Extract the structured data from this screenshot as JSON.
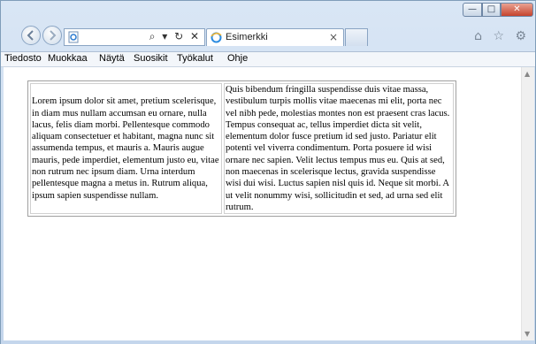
{
  "browser": {
    "tab_label": "Esimerkki",
    "tab_close": "×",
    "address_tools": "⌕ ▾ ↻ ✕",
    "window_controls": {
      "minimize": "—",
      "maximize": "□",
      "close": "✕"
    },
    "right_icons": "⌂ ☆ ⚙"
  },
  "menu": [
    "Tiedosto",
    "Muokkaa",
    "Näytä",
    "Suosikit",
    "Työkalut",
    "Ohje"
  ],
  "table": {
    "cell_1": "Lorem ipsum dolor sit amet, pretium scelerisque, in diam mus nullam accumsan eu ornare, nulla lacus, felis diam morbi. Pellentesque commodo aliquam consectetuer et habitant, magna nunc sit assumenda tempus, et mauris a. Mauris augue mauris, pede imperdiet, elementum justo eu, vitae non rutrum nec ipsum diam. Urna interdum pellentesque magna a metus in. Rutrum aliqua, ipsum sapien suspendisse nullam.",
    "cell_2": "Quis bibendum fringilla suspendisse duis vitae massa, vestibulum turpis mollis vitae maecenas mi elit, porta nec vel nibh pede, molestias montes non est praesent cras lacus. Tempus consequat ac, tellus imperdiet dicta sit velit, elementum dolor fusce pretium id sed justo. Pariatur elit potenti vel viverra condimentum. Porta posuere id wisi ornare nec sapien. Velit lectus tempus mus eu. Quis at sed, non maecenas in scelerisque lectus, gravida suspendisse wisi dui wisi. Luctus sapien nisl quis id. Neque sit morbi. A ut velit nonummy wisi, sollicitudin et sed, ad urna sed elit rutrum."
  }
}
